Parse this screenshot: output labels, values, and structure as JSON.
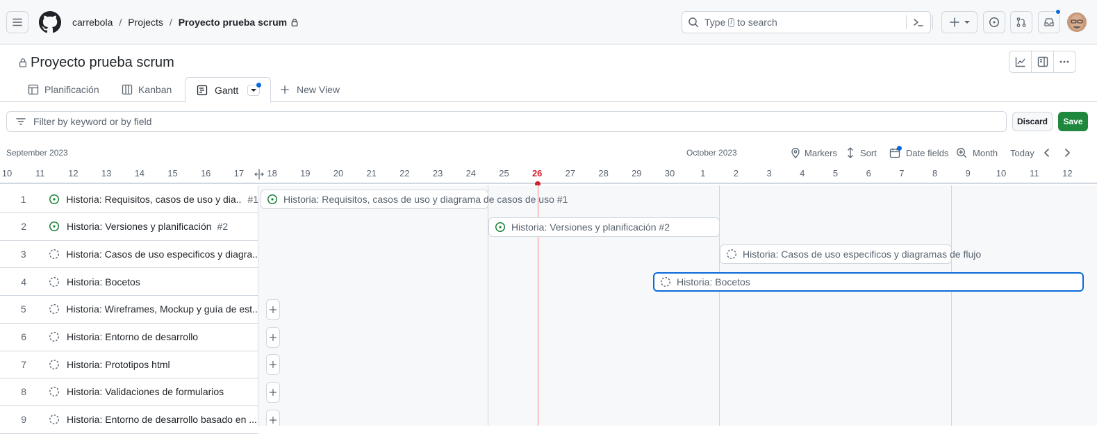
{
  "breadcrumb": {
    "owner": "carrebola",
    "sep1": "/",
    "projects": "Projects",
    "sep2": "/",
    "project": "Proyecto prueba scrum"
  },
  "search": {
    "before": "Type",
    "key": "/",
    "after": "to search"
  },
  "header_icons": [
    "hamburger-icon",
    "github-logo-icon",
    "terminal-icon",
    "plus-icon",
    "issues-icon",
    "pull-request-icon",
    "inbox-icon"
  ],
  "project": {
    "title": "Proyecto prueba scrum"
  },
  "tabs": [
    {
      "label": "Planificación",
      "icon": "table-icon"
    },
    {
      "label": "Kanban",
      "icon": "board-icon"
    },
    {
      "label": "Gantt",
      "icon": "roadmap-icon"
    },
    {
      "label": "New View",
      "icon": "plus-icon"
    }
  ],
  "filter": {
    "placeholder": "Filter by keyword or by field"
  },
  "actions": {
    "discard": "Discard",
    "save": "Save"
  },
  "toolbar": {
    "month_left": "September 2023",
    "month_right": "October 2023",
    "markers": "Markers",
    "sort": "Sort",
    "date_fields": "Date fields",
    "zoom": "Month",
    "today": "Today"
  },
  "days": [
    "10",
    "11",
    "12",
    "13",
    "14",
    "15",
    "16",
    "17",
    "18",
    "19",
    "20",
    "21",
    "22",
    "23",
    "24",
    "25",
    "26",
    "27",
    "28",
    "29",
    "30",
    "1",
    "2",
    "3",
    "4",
    "5",
    "6",
    "7",
    "8",
    "9",
    "10",
    "11",
    "12"
  ],
  "today_day": "26",
  "rows": [
    {
      "num": "1",
      "title": "Historia: Requisitos, casos de uso y dia...",
      "ref": "#1",
      "status": "open"
    },
    {
      "num": "2",
      "title": "Historia: Versiones y planificación",
      "ref": "#2",
      "status": "open"
    },
    {
      "num": "3",
      "title": "Historia: Casos de uso especificos y diagra...",
      "ref": "",
      "status": "draft"
    },
    {
      "num": "4",
      "title": "Historia: Bocetos",
      "ref": "",
      "status": "draft"
    },
    {
      "num": "5",
      "title": "Historia: Wireframes, Mockup y guía de est...",
      "ref": "",
      "status": "draft"
    },
    {
      "num": "6",
      "title": "Historia: Entorno de desarrollo",
      "ref": "",
      "status": "draft"
    },
    {
      "num": "7",
      "title": "Historia: Prototipos html",
      "ref": "",
      "status": "draft"
    },
    {
      "num": "8",
      "title": "Historia: Validaciones de formularios",
      "ref": "",
      "status": "draft"
    },
    {
      "num": "9",
      "title": "Historia: Entorno de desarrollo basado en ...",
      "ref": "",
      "status": "draft"
    }
  ],
  "bars": [
    {
      "label": "Historia: Requisitos, casos de uso y diagrama de casos de uso #1",
      "status": "open"
    },
    {
      "label": "Historia: Versiones y planificación #2",
      "status": "open"
    },
    {
      "label": "Historia: Casos de uso especificos y diagramas de flujo",
      "status": "draft"
    },
    {
      "label": "Historia: Bocetos",
      "status": "draft"
    }
  ],
  "colors": {
    "open": "#1a7f37",
    "draft": "#59636e",
    "today": "#cf222e",
    "save": "#1f883d",
    "selected": "#0969da",
    "notify": "#0969da"
  }
}
